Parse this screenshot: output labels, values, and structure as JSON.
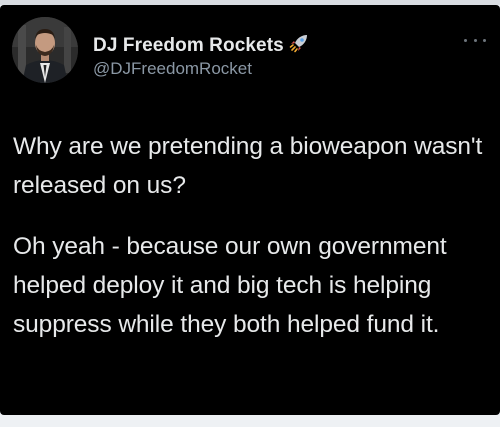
{
  "tweet": {
    "display_name": "DJ Freedom Rockets",
    "handle": "@DJFreedomRocket",
    "name_emoji_icon": "rocket-icon",
    "more_icon": "more-options-icon",
    "paragraphs": [
      "Why are we pretending a bioweapon wasn't released on us?",
      "Oh yeah - because our own government helped deploy it and big tech is helping suppress while they both helped fund it."
    ]
  },
  "colors": {
    "background": "#000000",
    "primary_text": "#e7e9ea",
    "secondary_text": "#8b98a5",
    "frame": "#e9edf2"
  }
}
